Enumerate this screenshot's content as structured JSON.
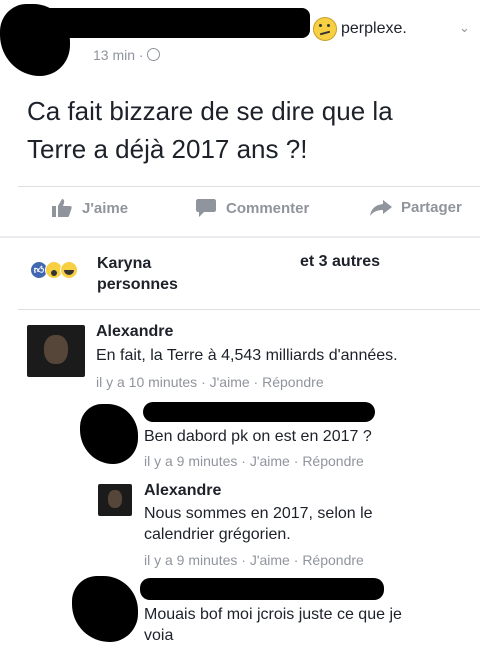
{
  "post": {
    "feeling": "perplexe.",
    "time": "13 min",
    "text_line1": "Ca fait bizzare de se dire que la",
    "text_line2": "Terre a déjà 2017 ans ?!"
  },
  "actions": {
    "like": "J'aime",
    "comment": "Commenter",
    "share": "Partager"
  },
  "reactions": {
    "names": "Karyna",
    "others": "et 3 autres",
    "persons": "personnes"
  },
  "comments": [
    {
      "name": "Alexandre",
      "text": "En fait, la Terre à 4,543 milliards d'années.",
      "time": "il y a 10 minutes",
      "like": "J'aime",
      "reply": "Répondre"
    },
    {
      "text": "Ben dabord pk on est en 2017 ?",
      "time": "il y a 9 minutes",
      "like": "J'aime",
      "reply": "Répondre"
    },
    {
      "name": "Alexandre",
      "text_line1": "Nous sommes en 2017, selon le",
      "text_line2": "calendrier grégorien.",
      "time": "il y a 9 minutes",
      "like": "J'aime",
      "reply": "Répondre"
    },
    {
      "text_line1": "Mouais bof moi jcrois juste ce que je",
      "text_line2": "voia"
    }
  ],
  "separator": "·",
  "colors": {
    "link": "#365899",
    "meta": "#90949c",
    "border": "#dddfe2",
    "like_blue": "#4267b2"
  }
}
